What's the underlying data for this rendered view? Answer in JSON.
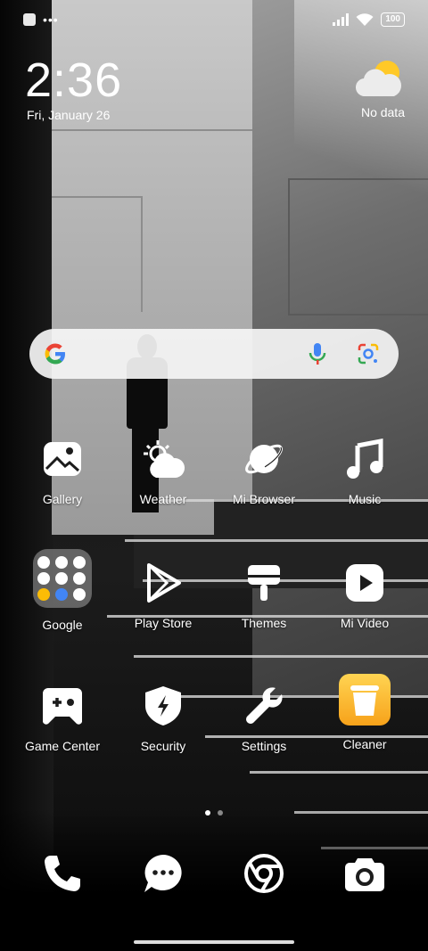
{
  "status_bar": {
    "battery": "100",
    "left_icons": [
      "square-notification-icon",
      "more-dots-icon"
    ],
    "right_icons": [
      "signal-icon",
      "wifi-icon",
      "battery-icon"
    ]
  },
  "clock": {
    "time": "2:36",
    "date": "Fri, January 26"
  },
  "weather_widget": {
    "status": "No data",
    "icon": "partly-cloudy-icon"
  },
  "search_bar": {
    "icons": [
      "google-logo-icon",
      "microphone-icon",
      "google-lens-icon"
    ]
  },
  "apps": [
    {
      "label": "Gallery",
      "icon": "gallery-icon"
    },
    {
      "label": "Weather",
      "icon": "weather-icon"
    },
    {
      "label": "Mi Browser",
      "icon": "browser-icon"
    },
    {
      "label": "Music",
      "icon": "music-note-icon"
    },
    {
      "label": "Google",
      "icon": "google-folder-icon"
    },
    {
      "label": "Play Store",
      "icon": "play-store-icon"
    },
    {
      "label": "Themes",
      "icon": "paint-brush-icon"
    },
    {
      "label": "Mi Video",
      "icon": "video-play-icon"
    },
    {
      "label": "Game Center",
      "icon": "gamepad-icon"
    },
    {
      "label": "Security",
      "icon": "shield-bolt-icon"
    },
    {
      "label": "Settings",
      "icon": "wrench-icon"
    },
    {
      "label": "Cleaner",
      "icon": "trash-icon"
    }
  ],
  "page_indicator": {
    "pages": 2,
    "current": 1
  },
  "dock": [
    {
      "icon": "phone-icon"
    },
    {
      "icon": "messages-icon"
    },
    {
      "icon": "chrome-icon"
    },
    {
      "icon": "camera-icon"
    }
  ],
  "colors": {
    "cleaner_accent": "#f7a21a",
    "text": "#ffffff"
  }
}
